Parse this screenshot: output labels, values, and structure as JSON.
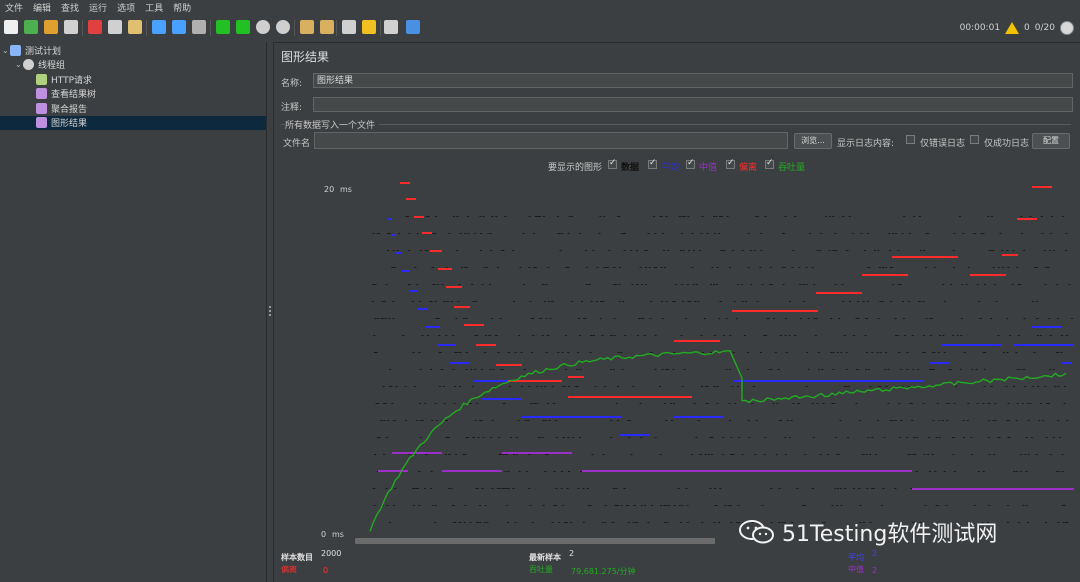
{
  "menu": [
    "文件",
    "编辑",
    "查找",
    "运行",
    "选项",
    "工具",
    "帮助"
  ],
  "toolbar": {
    "icons": [
      "new-icon",
      "templates-icon",
      "open-icon",
      "save-icon",
      "cut-icon",
      "copy-icon",
      "paste-icon",
      "expand-icon",
      "collapse-icon",
      "toggle-icon",
      "start-icon",
      "start-no-pause-icon",
      "stop-icon",
      "shutdown-icon",
      "clear-icon",
      "clear-all-icon",
      "search-icon",
      "reset-search-icon",
      "function-helper-icon",
      "help-icon"
    ],
    "timer": "00:00:01",
    "warnings": "0",
    "threads": "0/20"
  },
  "tree": [
    {
      "label": "测试计划",
      "depth": 0,
      "icon": "test-plan-icon",
      "expanded": true
    },
    {
      "label": "线程组",
      "depth": 1,
      "icon": "thread-group-icon",
      "expanded": true
    },
    {
      "label": "HTTP请求",
      "depth": 2,
      "icon": "http-request-icon"
    },
    {
      "label": "查看结果树",
      "depth": 2,
      "icon": "listener-icon"
    },
    {
      "label": "聚合报告",
      "depth": 2,
      "icon": "listener-icon"
    },
    {
      "label": "图形结果",
      "depth": 2,
      "icon": "listener-icon",
      "selected": true
    }
  ],
  "panel": {
    "title": "图形结果",
    "name_label": "名称:",
    "name_value": "图形结果",
    "comment_label": "注释:",
    "comment_value": "",
    "group_title": "所有数据写入一个文件",
    "file_label": "文件名",
    "file_value": "",
    "browse_button": "浏览...",
    "log_content_label": "显示日志内容:",
    "errors_only_label": "仅错误日志",
    "success_only_label": "仅成功日志",
    "configure_button": "配置"
  },
  "graph_options": {
    "label": "要显示的图形",
    "items": [
      {
        "label": "数据",
        "checked": true,
        "color": "#000000"
      },
      {
        "label": "平均",
        "checked": true,
        "color": "#2a2aff"
      },
      {
        "label": "中值",
        "checked": true,
        "color": "#9b30c8"
      },
      {
        "label": "偏离",
        "checked": true,
        "color": "#ff2a2a"
      },
      {
        "label": "吞吐量",
        "checked": true,
        "color": "#22aa22"
      }
    ]
  },
  "graph": {
    "y_max_label": "20",
    "y_min_label": "0",
    "y_unit": "ms"
  },
  "stats": {
    "samples_label": "样本数目",
    "samples_value": "2000",
    "deviation_label": "偏离",
    "deviation_value": "0",
    "latest_label": "最新样本",
    "latest_value": "2",
    "throughput_label": "吞吐量",
    "throughput_value": "79,681.275/分钟",
    "average_label": "平均",
    "average_value": "2",
    "median_label": "中值",
    "median_value": "2"
  },
  "watermark": "51Testing软件测试网"
}
